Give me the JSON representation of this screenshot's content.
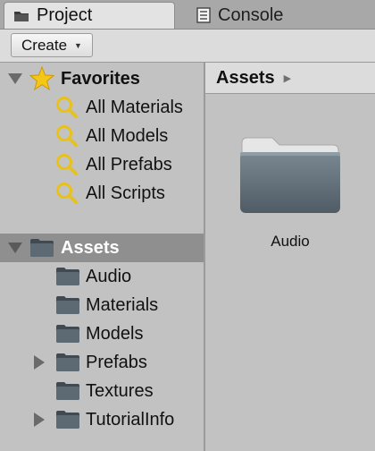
{
  "tabs": [
    {
      "label": "Project",
      "icon": "folder-icon",
      "active": true
    },
    {
      "label": "Console",
      "icon": "console-icon",
      "active": false
    }
  ],
  "toolbar": {
    "create_label": "Create",
    "dropdown_icon": "chevron-down-icon"
  },
  "favorites": {
    "label": "Favorites",
    "icon": "star-icon",
    "expanded": true,
    "items": [
      {
        "label": "All Materials",
        "icon": "search-icon"
      },
      {
        "label": "All Models",
        "icon": "search-icon"
      },
      {
        "label": "All Prefabs",
        "icon": "search-icon"
      },
      {
        "label": "All Scripts",
        "icon": "search-icon"
      }
    ]
  },
  "assets": {
    "label": "Assets",
    "icon": "folder-icon",
    "expanded": true,
    "selected": true,
    "children": [
      {
        "label": "Audio",
        "has_children": false
      },
      {
        "label": "Materials",
        "has_children": false
      },
      {
        "label": "Models",
        "has_children": false
      },
      {
        "label": "Prefabs",
        "has_children": true
      },
      {
        "label": "Textures",
        "has_children": false
      },
      {
        "label": "TutorialInfo",
        "has_children": true
      }
    ]
  },
  "right_panel": {
    "breadcrumb": "Assets",
    "breadcrumb_arrow_icon": "chevron-right-icon",
    "items": [
      {
        "label": "Audio",
        "icon": "folder-icon"
      }
    ]
  },
  "colors": {
    "panel_bg": "#c2c2c2",
    "selected_bg": "#8f8f8f",
    "folder": "#5d6a73",
    "star": "#f5c518",
    "search_icon": "#e8c21a"
  }
}
